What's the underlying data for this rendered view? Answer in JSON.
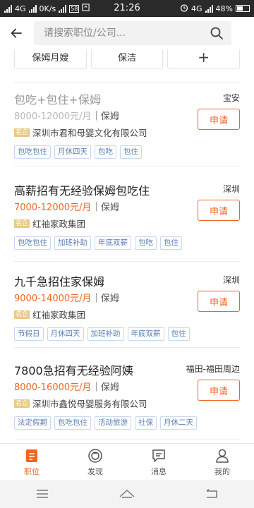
{
  "status": {
    "carrier": "4G",
    "net_speed": "0K/s",
    "notif_badge": "58",
    "time": "21:26",
    "net_type": "4G",
    "battery": "48%"
  },
  "search": {
    "placeholder": "请搜索职位/公司..."
  },
  "filter_chips": [
    {
      "label": "保姆月嫂"
    },
    {
      "label": "保洁"
    },
    {
      "label": "+"
    }
  ],
  "jobs": [
    {
      "title": "包吃+包住+保姆",
      "location": "宝安",
      "salary": "8000-12000元/月",
      "category": "保姆",
      "company_badge": "名企",
      "company": "深圳市君和母婴文化有限公司",
      "apply_label": "申请",
      "tags": [
        "包吃包住",
        "月休四天",
        "包吃",
        "包住"
      ]
    },
    {
      "title": "高薪招有无经验保姆包吃住",
      "location": "深圳",
      "salary": "7000-12000元/月",
      "category": "保姆",
      "company_badge": "名企",
      "company": "红袖家政集团",
      "apply_label": "申请",
      "tags": [
        "包吃包住",
        "加班补助",
        "年底双薪",
        "包吃",
        "包住"
      ]
    },
    {
      "title": "九千急招住家保姆",
      "location": "深圳",
      "salary": "9000-14000元/月",
      "category": "保姆",
      "company_badge": "名企",
      "company": "红袖家政集团",
      "apply_label": "申请",
      "tags": [
        "节假日",
        "月休四天",
        "加班补助",
        "年底双薪",
        "包住"
      ]
    },
    {
      "title": "7800急招有无经验阿姨",
      "location": "福田-福田周边",
      "salary": "8000-16000元/月",
      "category": "保姆",
      "company_badge": "名企",
      "company": "深圳市鑫悦母婴服务有限公司",
      "apply_label": "申请",
      "tags": [
        "法定假期",
        "包吃包住",
        "活动旅游",
        "社保",
        "月休二天"
      ]
    }
  ],
  "tabbar": [
    {
      "label": "职位",
      "icon": "job-list-icon"
    },
    {
      "label": "发现",
      "icon": "discover-icon"
    },
    {
      "label": "消息",
      "icon": "message-icon"
    },
    {
      "label": "我的",
      "icon": "profile-icon"
    }
  ],
  "colors": {
    "accent": "#f26522",
    "tag_text": "#5a7db5",
    "tag_border": "#c9d8ee",
    "badge_bg": "#e8c985"
  }
}
